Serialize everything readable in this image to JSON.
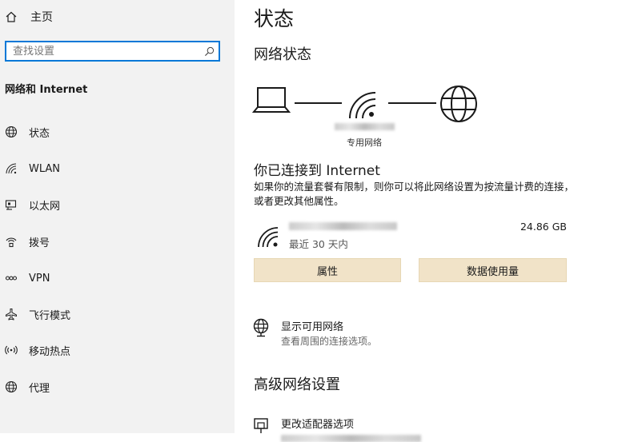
{
  "sidebar": {
    "home_label": "主页",
    "search_placeholder": "查找设置",
    "section_title": "网络和 Internet",
    "items": [
      {
        "label": "状态",
        "icon": "globe-icon"
      },
      {
        "label": "WLAN",
        "icon": "wifi-icon"
      },
      {
        "label": "以太网",
        "icon": "ethernet-icon"
      },
      {
        "label": "拨号",
        "icon": "dialup-icon"
      },
      {
        "label": "VPN",
        "icon": "vpn-icon"
      },
      {
        "label": "飞行模式",
        "icon": "airplane-icon"
      },
      {
        "label": "移动热点",
        "icon": "hotspot-icon"
      },
      {
        "label": "代理",
        "icon": "globe-icon"
      }
    ]
  },
  "main": {
    "page_title": "状态",
    "network_status_heading": "网络状态",
    "network_profile": "专用网络",
    "connected_title": "你已连接到 Internet",
    "connected_desc": "如果你的流量套餐有限制，则你可以将此网络设置为按流量计费的连接，或者更改其他属性。",
    "usage_period": "最近 30 天内",
    "usage_amount": "24.86 GB",
    "properties_button": "属性",
    "data_usage_button": "数据使用量",
    "show_networks_title": "显示可用网络",
    "show_networks_sub": "查看周围的连接选项。",
    "advanced_heading": "高级网络设置",
    "adapter_options_title": "更改适配器选项"
  },
  "colors": {
    "accent": "#0078d7",
    "button_bg": "#f1e3c8",
    "sidebar_bg": "#f2f2f2"
  }
}
